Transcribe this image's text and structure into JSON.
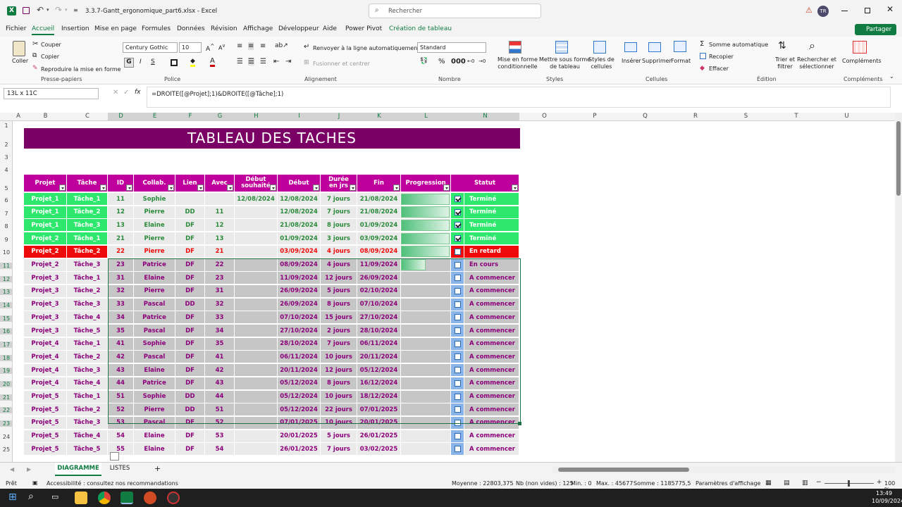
{
  "window": {
    "filename": "3.3.7-Gantt_ergonomique_part6.xlsx",
    "sep": "-",
    "app": "Excel",
    "search_placeholder": "Rechercher",
    "user_initials": "TR"
  },
  "menu": [
    "Fichier",
    "Accueil",
    "Insertion",
    "Mise en page",
    "Formules",
    "Données",
    "Révision",
    "Affichage",
    "Développeur",
    "Aide",
    "Power Pivot",
    "Création de tableau"
  ],
  "share_label": "Partager",
  "ribbon": {
    "paste": "Coller",
    "cut": "Couper",
    "copy": "Copier",
    "format_painter": "Reproduire la mise en forme",
    "clipboard_group": "Presse-papiers",
    "font_name": "Century Gothic",
    "font_size": "10",
    "font_group": "Police",
    "wrap": "Renvoyer à la ligne automatiquement",
    "merge": "Fusionner et centrer",
    "alignment_group": "Alignement",
    "number_format": "Standard",
    "number_group": "Nombre",
    "cond_format_1": "Mise en forme",
    "cond_format_2": "conditionnelle",
    "table_format_1": "Mettre sous forme",
    "table_format_2": "de tableau",
    "cell_styles_1": "Styles de",
    "cell_styles_2": "cellules",
    "styles_group": "Styles",
    "insert": "Insérer",
    "delete": "Supprimer",
    "format": "Format",
    "cells_group": "Cellules",
    "autosum": "Somme automatique",
    "fill": "Recopier",
    "clear": "Effacer",
    "sort_1": "Trier et",
    "sort_2": "filtrer",
    "find_1": "Rechercher et",
    "find_2": "sélectionner",
    "editing_group": "Édition",
    "addins": "Compléments",
    "addins_group": "Compléments"
  },
  "formula_bar": {
    "name_box": "13L x 11C",
    "fx": "fx",
    "formula": "=DROITE([@Projet];1)&DROITE([@Tâche];1)"
  },
  "columns": [
    "A",
    "B",
    "C",
    "D",
    "E",
    "F",
    "G",
    "H",
    "I",
    "J",
    "K",
    "L",
    "M",
    "N",
    "O",
    "P",
    "Q",
    "R",
    "S",
    "T",
    "U"
  ],
  "rows": [
    "1",
    "2",
    "3",
    "4",
    "5",
    "6",
    "7",
    "8",
    "9",
    "10",
    "11",
    "12",
    "13",
    "14",
    "15",
    "16",
    "17",
    "18",
    "19",
    "20",
    "21",
    "22",
    "23",
    "24",
    "25"
  ],
  "sheet_title": "TABLEAU  DES  TACHES",
  "headers": [
    "Projet",
    "Tâche",
    "ID",
    "Collab.",
    "Lien",
    "Avec",
    "Début souhaité",
    "Début",
    "Durée en jrs",
    "Fin",
    "Progression",
    "Statut"
  ],
  "table": [
    {
      "p": "Projet_1",
      "t": "Tâche_1",
      "id": "11",
      "c": "Sophie",
      "l": "",
      "a": "",
      "ds": "12/08/2024",
      "d": "12/08/2024",
      "du": "7 jours",
      "f": "21/08/2024",
      "prog": 1,
      "chk": true,
      "s": "Terminé",
      "st": "done"
    },
    {
      "p": "Projet_1",
      "t": "Tâche_2",
      "id": "12",
      "c": "Pierre",
      "l": "DD",
      "a": "11",
      "ds": "",
      "d": "12/08/2024",
      "du": "7 jours",
      "f": "21/08/2024",
      "prog": 1,
      "chk": true,
      "s": "Terminé",
      "st": "done"
    },
    {
      "p": "Projet_1",
      "t": "Tâche_3",
      "id": "13",
      "c": "Elaine",
      "l": "DF",
      "a": "12",
      "ds": "",
      "d": "21/08/2024",
      "du": "8 jours",
      "f": "01/09/2024",
      "prog": 1,
      "chk": true,
      "s": "Terminé",
      "st": "done"
    },
    {
      "p": "Projet_2",
      "t": "Tâche_1",
      "id": "21",
      "c": "Pierre",
      "l": "DF",
      "a": "13",
      "ds": "",
      "d": "01/09/2024",
      "du": "3 jours",
      "f": "03/09/2024",
      "prog": 1,
      "chk": true,
      "s": "Terminé",
      "st": "done"
    },
    {
      "p": "Projet_2",
      "t": "Tâche_2",
      "id": "22",
      "c": "Pierre",
      "l": "DF",
      "a": "21",
      "ds": "",
      "d": "03/09/2024",
      "du": "4 jours",
      "f": "08/09/2024",
      "prog": 1,
      "chk": false,
      "s": "En retard",
      "st": "late"
    },
    {
      "p": "Projet_2",
      "t": "Tâche_3",
      "id": "23",
      "c": "Patrice",
      "l": "DF",
      "a": "22",
      "ds": "",
      "d": "08/09/2024",
      "du": "4 jours",
      "f": "11/09/2024",
      "prog": 0.5,
      "chk": false,
      "s": "En cours",
      "st": "prog"
    },
    {
      "p": "Projet_3",
      "t": "Tâche_1",
      "id": "31",
      "c": "Elaine",
      "l": "DF",
      "a": "23",
      "ds": "",
      "d": "11/09/2024",
      "du": "12 jours",
      "f": "26/09/2024",
      "prog": 0,
      "chk": false,
      "s": "A commencer",
      "st": "todo"
    },
    {
      "p": "Projet_3",
      "t": "Tâche_2",
      "id": "32",
      "c": "Pierre",
      "l": "DF",
      "a": "31",
      "ds": "",
      "d": "26/09/2024",
      "du": "5 jours",
      "f": "02/10/2024",
      "prog": 0,
      "chk": false,
      "s": "A commencer",
      "st": "todo"
    },
    {
      "p": "Projet_3",
      "t": "Tâche_3",
      "id": "33",
      "c": "Pascal",
      "l": "DD",
      "a": "32",
      "ds": "",
      "d": "26/09/2024",
      "du": "8 jours",
      "f": "07/10/2024",
      "prog": 0,
      "chk": false,
      "s": "A commencer",
      "st": "todo"
    },
    {
      "p": "Projet_3",
      "t": "Tâche_4",
      "id": "34",
      "c": "Patrice",
      "l": "DF",
      "a": "33",
      "ds": "",
      "d": "07/10/2024",
      "du": "15 jours",
      "f": "27/10/2024",
      "prog": 0,
      "chk": false,
      "s": "A commencer",
      "st": "todo"
    },
    {
      "p": "Projet_3",
      "t": "Tâche_5",
      "id": "35",
      "c": "Pascal",
      "l": "DF",
      "a": "34",
      "ds": "",
      "d": "27/10/2024",
      "du": "2 jours",
      "f": "28/10/2024",
      "prog": 0,
      "chk": false,
      "s": "A commencer",
      "st": "todo"
    },
    {
      "p": "Projet_4",
      "t": "Tâche_1",
      "id": "41",
      "c": "Sophie",
      "l": "DF",
      "a": "35",
      "ds": "",
      "d": "28/10/2024",
      "du": "7 jours",
      "f": "06/11/2024",
      "prog": 0,
      "chk": false,
      "s": "A commencer",
      "st": "todo"
    },
    {
      "p": "Projet_4",
      "t": "Tâche_2",
      "id": "42",
      "c": "Pascal",
      "l": "DF",
      "a": "41",
      "ds": "",
      "d": "06/11/2024",
      "du": "10 jours",
      "f": "20/11/2024",
      "prog": 0,
      "chk": false,
      "s": "A commencer",
      "st": "todo"
    },
    {
      "p": "Projet_4",
      "t": "Tâche_3",
      "id": "43",
      "c": "Elaine",
      "l": "DF",
      "a": "42",
      "ds": "",
      "d": "20/11/2024",
      "du": "12 jours",
      "f": "05/12/2024",
      "prog": 0,
      "chk": false,
      "s": "A commencer",
      "st": "todo"
    },
    {
      "p": "Projet_4",
      "t": "Tâche_4",
      "id": "44",
      "c": "Patrice",
      "l": "DF",
      "a": "43",
      "ds": "",
      "d": "05/12/2024",
      "du": "8 jours",
      "f": "16/12/2024",
      "prog": 0,
      "chk": false,
      "s": "A commencer",
      "st": "todo"
    },
    {
      "p": "Projet_5",
      "t": "Tâche_1",
      "id": "51",
      "c": "Sophie",
      "l": "DD",
      "a": "44",
      "ds": "",
      "d": "05/12/2024",
      "du": "10 jours",
      "f": "18/12/2024",
      "prog": 0,
      "chk": false,
      "s": "A commencer",
      "st": "todo"
    },
    {
      "p": "Projet_5",
      "t": "Tâche_2",
      "id": "52",
      "c": "Pierre",
      "l": "DD",
      "a": "51",
      "ds": "",
      "d": "05/12/2024",
      "du": "22 jours",
      "f": "07/01/2025",
      "prog": 0,
      "chk": false,
      "s": "A commencer",
      "st": "todo"
    },
    {
      "p": "Projet_5",
      "t": "Tâche_3",
      "id": "53",
      "c": "Pascal",
      "l": "DF",
      "a": "52",
      "ds": "",
      "d": "07/01/2025",
      "du": "10 jours",
      "f": "20/01/2025",
      "prog": 0,
      "chk": false,
      "s": "A commencer",
      "st": "todo"
    },
    {
      "p": "Projet_5",
      "t": "Tâche_4",
      "id": "54",
      "c": "Elaine",
      "l": "DF",
      "a": "53",
      "ds": "",
      "d": "20/01/2025",
      "du": "5 jours",
      "f": "26/01/2025",
      "prog": 0,
      "chk": false,
      "s": "A commencer",
      "st": "todo"
    },
    {
      "p": "Projet_5",
      "t": "Tâche_5",
      "id": "55",
      "c": "Elaine",
      "l": "DF",
      "a": "54",
      "ds": "",
      "d": "26/01/2025",
      "du": "7 jours",
      "f": "03/02/2025",
      "prog": 0,
      "chk": false,
      "s": "A commencer",
      "st": "todo"
    }
  ],
  "sheets": [
    "DIAGRAMME",
    "LISTES"
  ],
  "add_sheet": "+",
  "status": {
    "ready": "Prêt",
    "accessibility": "Accessibilité : consultez nos recommandations",
    "avg": "Moyenne : 22803,375",
    "count": "Nb (non vides) : 125",
    "min": "Min. : 0",
    "max": "Max. : 45677",
    "sum": "Somme : 1185775,5",
    "display": "Paramètres d'affichage",
    "zoom": "100 %"
  },
  "taskbar": {
    "time": "13:49",
    "date": "10/09/2024"
  },
  "colors": {
    "magenta": "#c0009c",
    "title_bg": "#7b0066",
    "done": "#2ee86e",
    "late": "#ee0a0a",
    "gray": "#c6c6c6",
    "purple_text": "#8b007a",
    "excel_green": "#107c41"
  }
}
